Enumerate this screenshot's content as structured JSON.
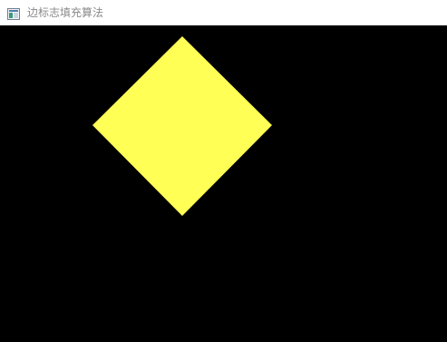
{
  "window": {
    "title": "边标志填充算法",
    "icon": "app-window-icon"
  },
  "canvas": {
    "background_color": "#000000",
    "shape": {
      "kind": "diamond",
      "fill_color": "#ffff55"
    }
  }
}
